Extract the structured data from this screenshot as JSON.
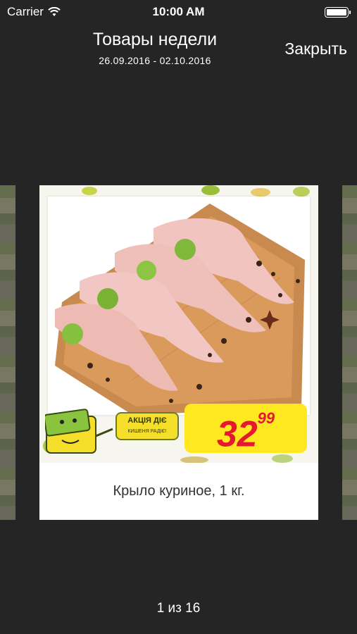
{
  "status_bar": {
    "carrier": "Carrier",
    "time": "10:00 AM"
  },
  "nav": {
    "title": "Товары недели",
    "date_range": "26.09.2016 - 02.10.2016",
    "close_label": "Закрыть"
  },
  "product": {
    "name": "Крыло куриное, 1 кг.",
    "promo_line1": "АКЦІЯ ДІЄ",
    "promo_line2": "КИШЕНЯ РАДІЄ!",
    "price_main": "32",
    "price_cents": "99"
  },
  "pager": {
    "label": "1 из 16"
  },
  "colors": {
    "background": "#252525",
    "price_badge": "#ffe81f",
    "price_text": "#e5192d"
  }
}
